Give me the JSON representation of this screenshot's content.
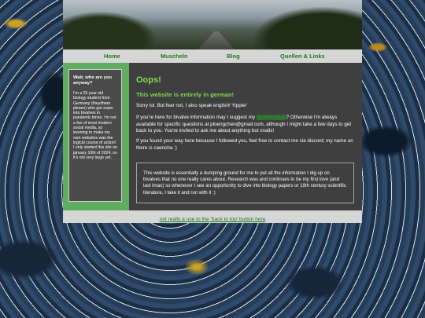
{
  "nav": {
    "items": [
      {
        "label": "Home"
      },
      {
        "label": "Muscheln"
      },
      {
        "label": "Blog"
      },
      {
        "label": "Quellen & Links"
      }
    ]
  },
  "sidebar": {
    "title": "Wait, who are you anyway?",
    "text": "I'm a 25 year old biology student from Germany (they/them please) who got super into bivalves in pandemic times. I'm not a fan of most modern social media, so learning to make my own websites was the logical course of action!\nI only started this site on january 10th of 2024, so it's not very large yet."
  },
  "main": {
    "heading": "Oops!",
    "subheading": "This website is entirely in german!",
    "p1": "Sorry lol. But fear not, I also speak english! Yippie!",
    "p2_before": "If you're here for bivalve information may I suggest my ",
    "p2_link": "sources page",
    "p2_after": "? Otherwise I'm always available for specific questions at ploengchen@gmail.com, although I might take a few days to get back to you. You're invited to ask me about anything but snails!",
    "p3": "If you found your way here because I followed you, feel free to contact me via discord; my name on there is caencha :)",
    "note": "This website is essentially a dumping ground for me to put all the information I dig up on bivalves that no one really cares about. Research was and continues to be my first love (and last lmao) so whenever I see an opportunity to dive into biology papers or 19th century scientific literature, I take it and run with it :)"
  },
  "footer": {
    "link": "not really a use to the 'back to top' button here"
  },
  "colors": {
    "accent_green": "#7ed957",
    "nav_link": "#1d7a1d",
    "sidebar_bg": "#5fae5f",
    "main_bg": "#3f3f3f"
  }
}
